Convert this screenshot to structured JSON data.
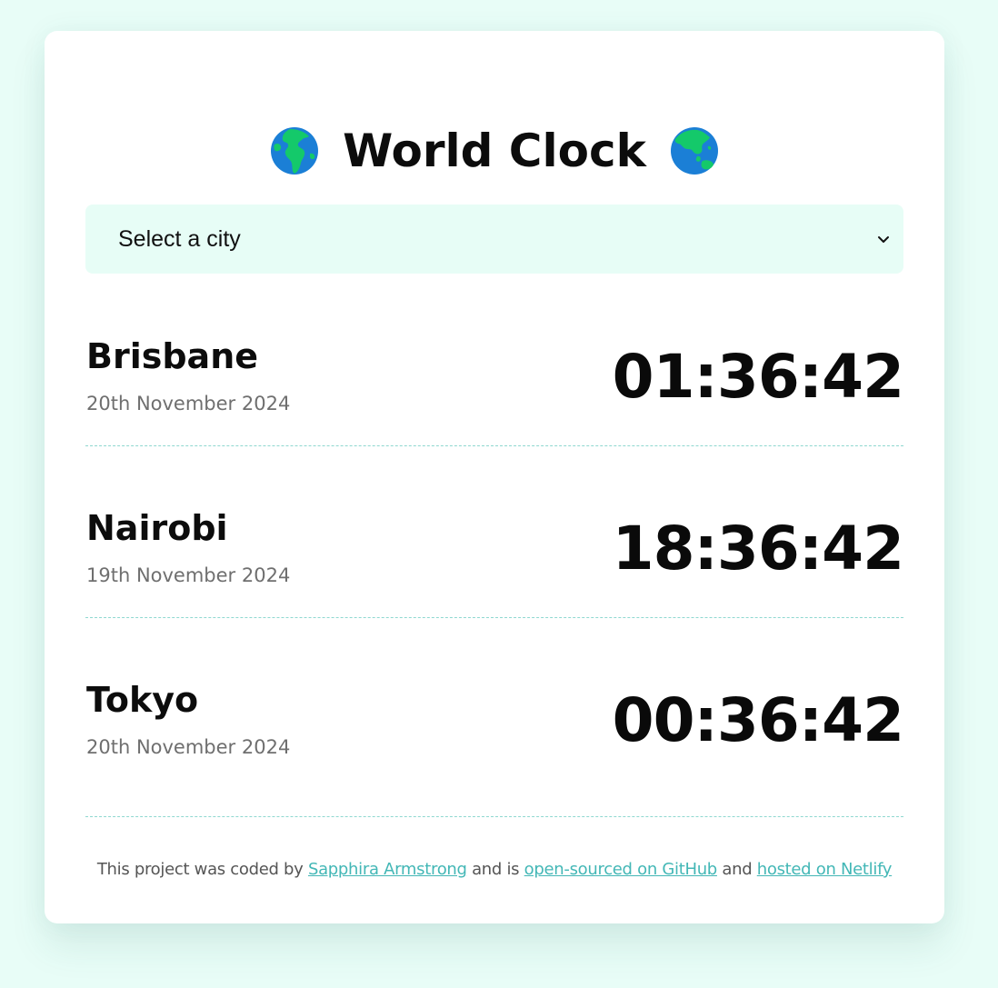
{
  "header": {
    "title": "World Clock",
    "globe_left_icon": "globe-europe-africa-icon",
    "globe_right_icon": "globe-asia-australia-icon"
  },
  "city_select": {
    "selected": "Select a city",
    "icon": "chevron-down-icon"
  },
  "cities": [
    {
      "name": "Brisbane",
      "date": "20th November 2024",
      "time": "01:36:42"
    },
    {
      "name": "Nairobi",
      "date": "19th November 2024",
      "time": "18:36:42"
    },
    {
      "name": "Tokyo",
      "date": "20th November 2024",
      "time": "00:36:42"
    }
  ],
  "footer": {
    "text_1": "This project was coded by",
    "author_link": "Sapphira Armstrong",
    "text_2": "and is",
    "github_link": "open-sourced on GitHub",
    "text_3": "and",
    "netlify_link": "hosted on Netlify"
  },
  "colors": {
    "page_background": "#e8fdf7",
    "card_background": "#ffffff",
    "select_background": "#e7fdf6",
    "link": "#43b7b6",
    "divider": "#8fd8d0",
    "date_text": "#6f6f6f"
  }
}
